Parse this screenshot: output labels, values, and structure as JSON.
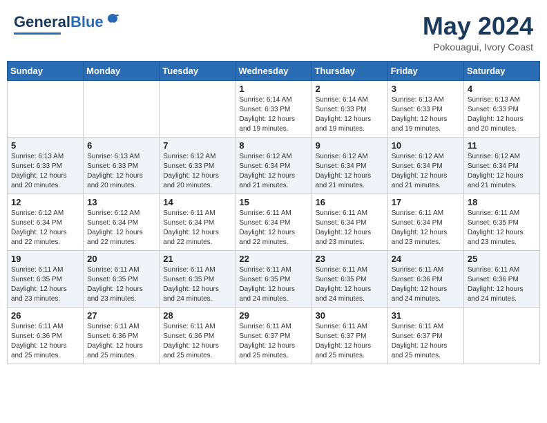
{
  "logo": {
    "line1": "General",
    "line2": "Blue"
  },
  "title": {
    "month_year": "May 2024",
    "location": "Pokouagui, Ivory Coast"
  },
  "header_days": [
    "Sunday",
    "Monday",
    "Tuesday",
    "Wednesday",
    "Thursday",
    "Friday",
    "Saturday"
  ],
  "weeks": [
    [
      {
        "day": "",
        "info": ""
      },
      {
        "day": "",
        "info": ""
      },
      {
        "day": "",
        "info": ""
      },
      {
        "day": "1",
        "info": "Sunrise: 6:14 AM\nSunset: 6:33 PM\nDaylight: 12 hours\nand 19 minutes."
      },
      {
        "day": "2",
        "info": "Sunrise: 6:14 AM\nSunset: 6:33 PM\nDaylight: 12 hours\nand 19 minutes."
      },
      {
        "day": "3",
        "info": "Sunrise: 6:13 AM\nSunset: 6:33 PM\nDaylight: 12 hours\nand 19 minutes."
      },
      {
        "day": "4",
        "info": "Sunrise: 6:13 AM\nSunset: 6:33 PM\nDaylight: 12 hours\nand 20 minutes."
      }
    ],
    [
      {
        "day": "5",
        "info": "Sunrise: 6:13 AM\nSunset: 6:33 PM\nDaylight: 12 hours\nand 20 minutes."
      },
      {
        "day": "6",
        "info": "Sunrise: 6:13 AM\nSunset: 6:33 PM\nDaylight: 12 hours\nand 20 minutes."
      },
      {
        "day": "7",
        "info": "Sunrise: 6:12 AM\nSunset: 6:33 PM\nDaylight: 12 hours\nand 20 minutes."
      },
      {
        "day": "8",
        "info": "Sunrise: 6:12 AM\nSunset: 6:34 PM\nDaylight: 12 hours\nand 21 minutes."
      },
      {
        "day": "9",
        "info": "Sunrise: 6:12 AM\nSunset: 6:34 PM\nDaylight: 12 hours\nand 21 minutes."
      },
      {
        "day": "10",
        "info": "Sunrise: 6:12 AM\nSunset: 6:34 PM\nDaylight: 12 hours\nand 21 minutes."
      },
      {
        "day": "11",
        "info": "Sunrise: 6:12 AM\nSunset: 6:34 PM\nDaylight: 12 hours\nand 21 minutes."
      }
    ],
    [
      {
        "day": "12",
        "info": "Sunrise: 6:12 AM\nSunset: 6:34 PM\nDaylight: 12 hours\nand 22 minutes."
      },
      {
        "day": "13",
        "info": "Sunrise: 6:12 AM\nSunset: 6:34 PM\nDaylight: 12 hours\nand 22 minutes."
      },
      {
        "day": "14",
        "info": "Sunrise: 6:11 AM\nSunset: 6:34 PM\nDaylight: 12 hours\nand 22 minutes."
      },
      {
        "day": "15",
        "info": "Sunrise: 6:11 AM\nSunset: 6:34 PM\nDaylight: 12 hours\nand 22 minutes."
      },
      {
        "day": "16",
        "info": "Sunrise: 6:11 AM\nSunset: 6:34 PM\nDaylight: 12 hours\nand 23 minutes."
      },
      {
        "day": "17",
        "info": "Sunrise: 6:11 AM\nSunset: 6:34 PM\nDaylight: 12 hours\nand 23 minutes."
      },
      {
        "day": "18",
        "info": "Sunrise: 6:11 AM\nSunset: 6:35 PM\nDaylight: 12 hours\nand 23 minutes."
      }
    ],
    [
      {
        "day": "19",
        "info": "Sunrise: 6:11 AM\nSunset: 6:35 PM\nDaylight: 12 hours\nand 23 minutes."
      },
      {
        "day": "20",
        "info": "Sunrise: 6:11 AM\nSunset: 6:35 PM\nDaylight: 12 hours\nand 23 minutes."
      },
      {
        "day": "21",
        "info": "Sunrise: 6:11 AM\nSunset: 6:35 PM\nDaylight: 12 hours\nand 24 minutes."
      },
      {
        "day": "22",
        "info": "Sunrise: 6:11 AM\nSunset: 6:35 PM\nDaylight: 12 hours\nand 24 minutes."
      },
      {
        "day": "23",
        "info": "Sunrise: 6:11 AM\nSunset: 6:35 PM\nDaylight: 12 hours\nand 24 minutes."
      },
      {
        "day": "24",
        "info": "Sunrise: 6:11 AM\nSunset: 6:36 PM\nDaylight: 12 hours\nand 24 minutes."
      },
      {
        "day": "25",
        "info": "Sunrise: 6:11 AM\nSunset: 6:36 PM\nDaylight: 12 hours\nand 24 minutes."
      }
    ],
    [
      {
        "day": "26",
        "info": "Sunrise: 6:11 AM\nSunset: 6:36 PM\nDaylight: 12 hours\nand 25 minutes."
      },
      {
        "day": "27",
        "info": "Sunrise: 6:11 AM\nSunset: 6:36 PM\nDaylight: 12 hours\nand 25 minutes."
      },
      {
        "day": "28",
        "info": "Sunrise: 6:11 AM\nSunset: 6:36 PM\nDaylight: 12 hours\nand 25 minutes."
      },
      {
        "day": "29",
        "info": "Sunrise: 6:11 AM\nSunset: 6:37 PM\nDaylight: 12 hours\nand 25 minutes."
      },
      {
        "day": "30",
        "info": "Sunrise: 6:11 AM\nSunset: 6:37 PM\nDaylight: 12 hours\nand 25 minutes."
      },
      {
        "day": "31",
        "info": "Sunrise: 6:11 AM\nSunset: 6:37 PM\nDaylight: 12 hours\nand 25 minutes."
      },
      {
        "day": "",
        "info": ""
      }
    ]
  ]
}
